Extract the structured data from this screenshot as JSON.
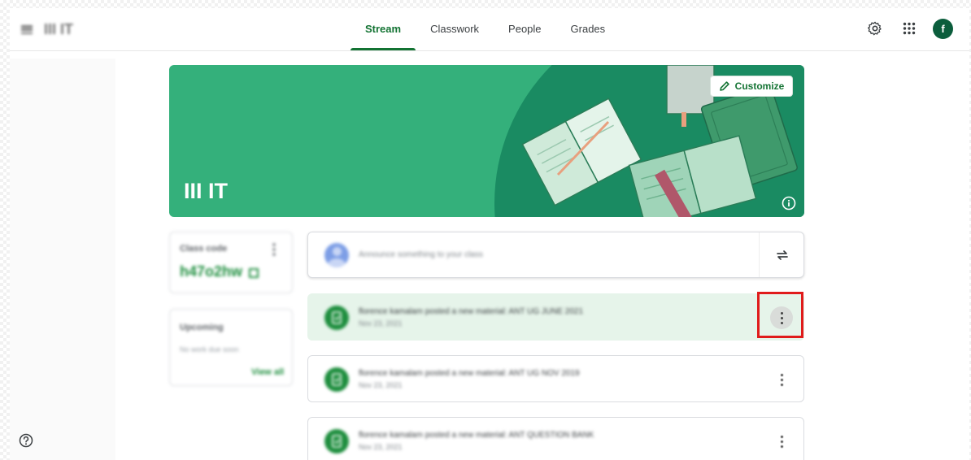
{
  "header": {
    "class_name": "III IT",
    "tabs": [
      {
        "label": "Stream",
        "active": true
      },
      {
        "label": "Classwork",
        "active": false
      },
      {
        "label": "People",
        "active": false
      },
      {
        "label": "Grades",
        "active": false
      }
    ],
    "avatar_letter": "f",
    "icons": [
      "menu-icon",
      "settings-icon",
      "apps-icon"
    ]
  },
  "banner": {
    "title": "III IT",
    "customize_label": "Customize",
    "color": "#34b07b",
    "icons": [
      "pencil-icon",
      "info-icon"
    ]
  },
  "class_code": {
    "label": "Class code",
    "value": "h47o2hw"
  },
  "upcoming": {
    "title": "Upcoming",
    "empty_text": "No work due soon",
    "link": "View all"
  },
  "announce": {
    "placeholder": "Announce something to your class",
    "icons": [
      "repost-icon"
    ]
  },
  "stream": [
    {
      "title": "florence kamalam posted a new material: ANT UG JUNE 2021",
      "date": "Nov 23, 2021",
      "highlighted": true
    },
    {
      "title": "florence kamalam posted a new material: ANT UG NOV 2019",
      "date": "Nov 23, 2021",
      "highlighted": false
    },
    {
      "title": "florence kamalam posted a new material: ANT QUESTION BANK",
      "date": "Nov 23, 2021",
      "highlighted": false
    }
  ],
  "colors": {
    "accent": "#137333",
    "highlight_row": "#e6f4ea",
    "annotation": "#e01b1b"
  }
}
